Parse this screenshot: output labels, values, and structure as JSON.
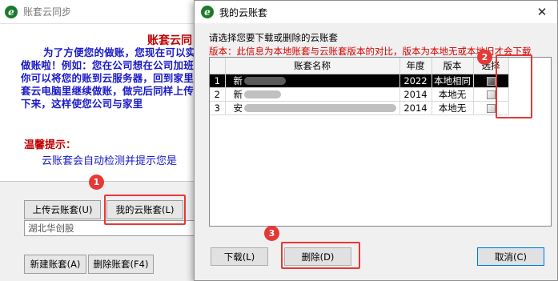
{
  "background_window": {
    "title": "账套云同步",
    "heading": "账套云同",
    "paragraph": "为了方便您的做账，您现在可以实现异地做账啦！例如：您在公司想在公司加班，此时你可以将您的账到云服务器，回到家里使用账套云电脑里继续做账，做完后同样上传据同步下来，这样使您公司与家里",
    "tip_title": "温馨提示：",
    "tip_text": "云账套会自动检测并提示您是",
    "upload_button": "上传云账套(U)",
    "my_cloud_button": "我的云账套(L)",
    "select_value": "湖北华创股",
    "new_account_button": "新建账套(A)",
    "delete_account_button": "删除账套(F4)"
  },
  "dialog": {
    "title": "我的云账套",
    "close_symbol": "✕",
    "instruction": "请选择您要下载或删除的云账套",
    "warning": "版本：此信息为本地账套与云账套版本的对比，版本为本地无或本地旧才会下载",
    "columns": [
      "",
      "账套名称",
      "年度",
      "版本",
      "选择"
    ],
    "rows": [
      {
        "index": "1",
        "name": "新",
        "year": "2022",
        "version": "本地相同",
        "selected": true
      },
      {
        "index": "2",
        "name": "新",
        "year": "2014",
        "version": "本地无",
        "selected": false
      },
      {
        "index": "3",
        "name": "安",
        "year": "2014",
        "version": "本地无",
        "selected": false
      }
    ],
    "download_button": "下载(L)",
    "delete_button": "删除(D)",
    "cancel_button": "取消(C)"
  },
  "annotations": {
    "step1": "1",
    "step2": "2",
    "step3": "3",
    "color": "#e53935"
  },
  "icons": {
    "app_icon_glyph": "e"
  }
}
